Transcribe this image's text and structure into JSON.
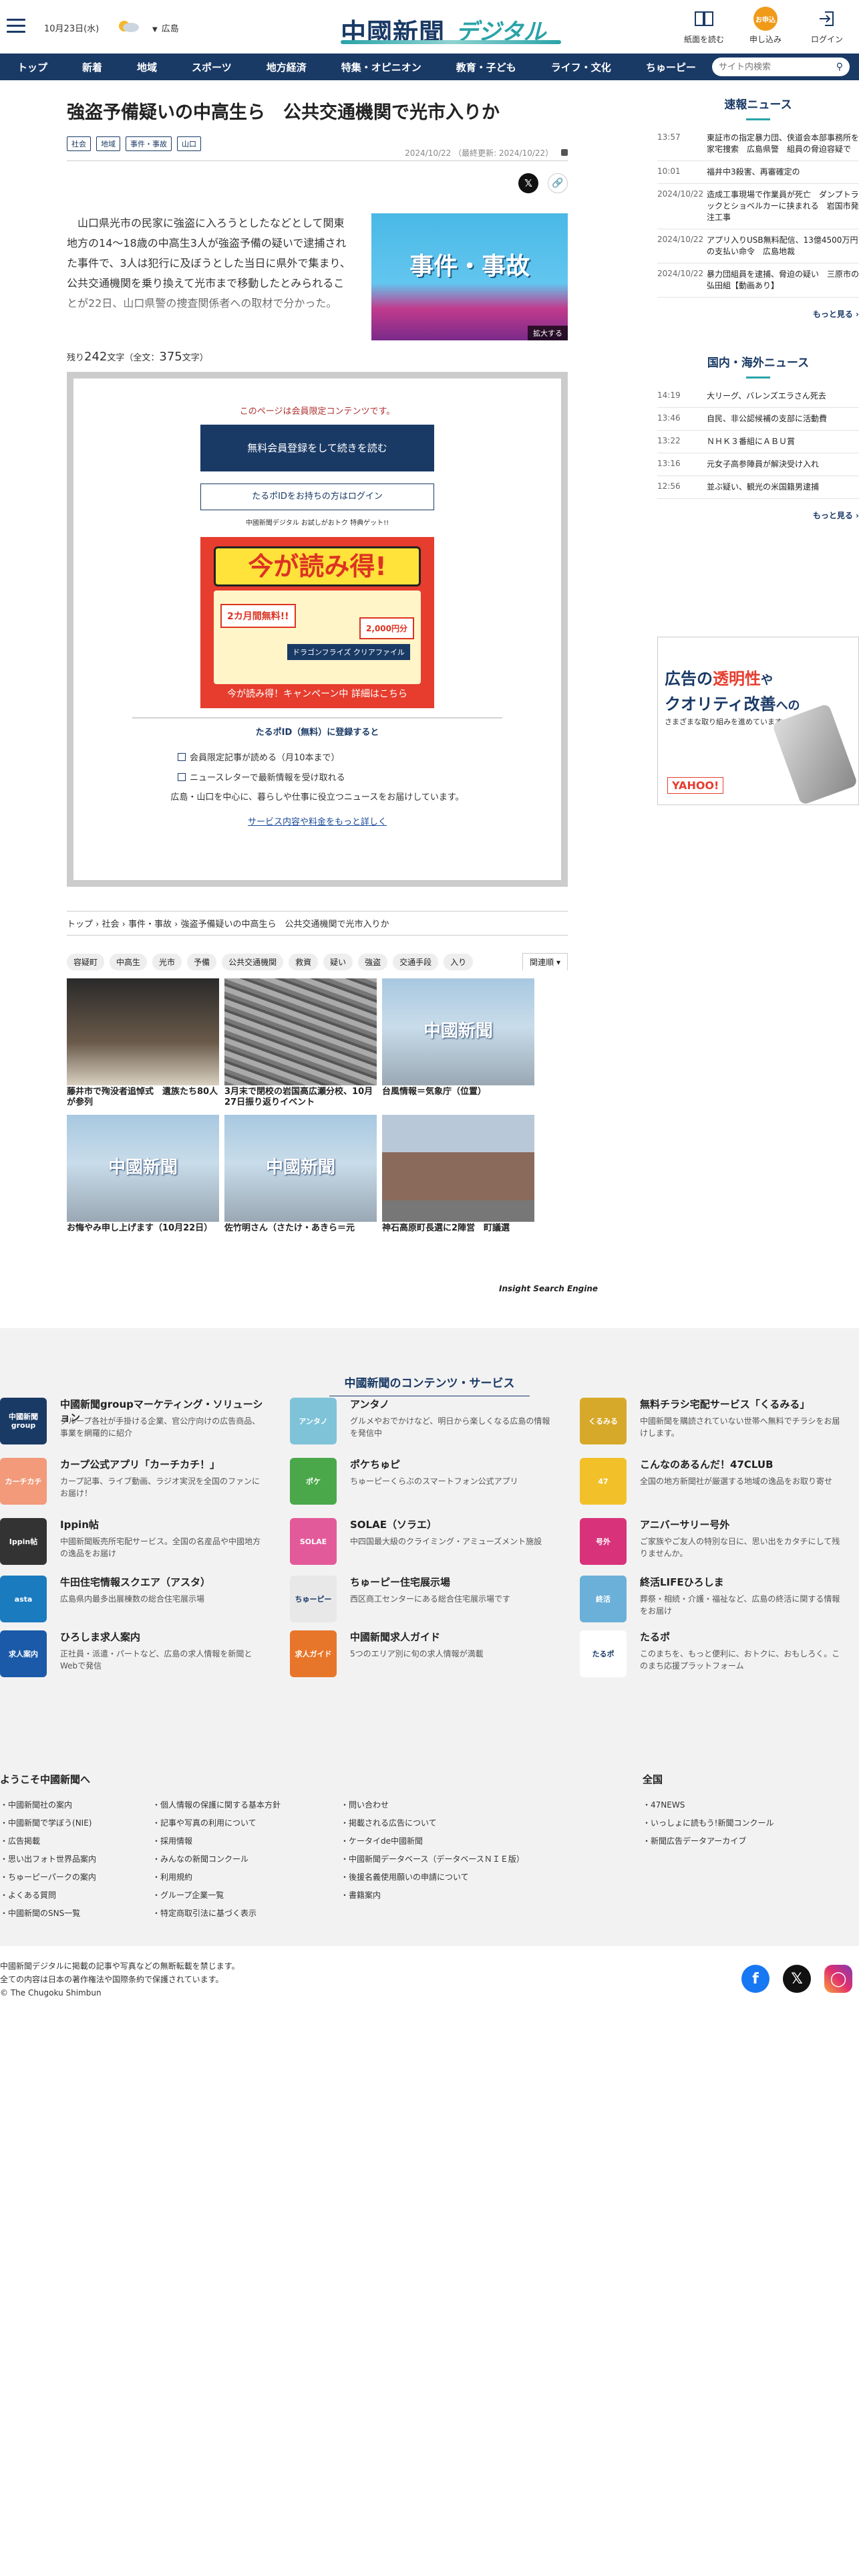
{
  "header": {
    "date": "10月23日(水)",
    "region": "広島",
    "logo_main": "中國新聞",
    "logo_sub": "デジタル",
    "icons": [
      {
        "label": "紙面を読む",
        "icon": "newspaper-icon"
      },
      {
        "label": "申し込み",
        "icon": "apply-icon",
        "badge": "お申込"
      },
      {
        "label": "ログイン",
        "icon": "login-icon"
      }
    ]
  },
  "nav": {
    "items": [
      "トップ",
      "新着",
      "地域",
      "スポーツ",
      "地方経済",
      "特集・オピニオン",
      "教育・子ども",
      "ライフ・文化",
      "ちゅーピー"
    ],
    "search_placeholder": "サイト内検索"
  },
  "article": {
    "title": "強盗予備疑いの中高生ら　公共交通機関で光市入りか",
    "tags": [
      "社会",
      "地域",
      "事件・事故",
      "山口"
    ],
    "date": "2024/10/22",
    "updated": "（最終更新: 2024/10/22）",
    "lead": "　山口県光市の民家に強盗に入ろうとしたなどとして関東地方の14～18歳の中高生3人が強盗予備の疑いで逮捕された事件で、3人は犯行に及ぼうとした当日に県外で集まり、公共交通機関を乗り換えて光市まで移動したとみられることが22日、山口県警の捜査関係者への取材で分かった。",
    "image_label": "事件・事故",
    "expand_label": "拡大する",
    "remain_prefix": "残り",
    "remain_count": "242",
    "remain_mid": "文字（全文：",
    "total_count": "375",
    "remain_suffix": "文字）"
  },
  "paywall": {
    "note": "このページは会員限定コンテンツです。",
    "register_btn": "無料会員登録をして続きを読む",
    "login_btn": "たるポIDをお持ちの方はログイン",
    "banner_top": "中國新聞デジタル お試しがおトク 特典ゲット!!",
    "banner_big": "今が読み得!",
    "banner_c1": "2カ月間無料!!",
    "banner_c2": "2,000円分",
    "banner_c3": "ドラゴンフライズ クリアファイル",
    "banner_bottom": "今が読み得！キャンペーン中 詳細はこちら",
    "sub_title": "たるポID（無料）に登録すると",
    "benefits": [
      "会員限定記事が読める（月10本まで）",
      "ニュースレターで最新情報を受け取れる"
    ],
    "desc": "広島・山口を中心に、暮らしや仕事に役立つニュースをお届けしています。",
    "more_link": "サービス内容や料金をもっと詳しく"
  },
  "breadcrumb": [
    "トップ",
    "社会",
    "事件・事故",
    "強盗予備疑いの中高生ら　公共交通機関で光市入りか"
  ],
  "keywords": [
    "容疑町",
    "中高生",
    "光市",
    "予備",
    "公共交通機関",
    "救資",
    "疑い",
    "強盗",
    "交通手段",
    "入り"
  ],
  "sort_label": "関連順",
  "related": [
    {
      "caption": "藤井市で殉没者追悼式　遺族たち80人が参列",
      "style": "photo1"
    },
    {
      "caption": "3月末で閉校の岩国高広瀬分校、10月27日振り返りイベント",
      "style": "photo2"
    },
    {
      "caption": "台風情報＝気象庁（位置）",
      "style": "cg"
    },
    {
      "caption": "お悔やみ申し上げます（10月22日）",
      "style": "cg"
    },
    {
      "caption": "佐竹明さん（さたけ・あきら＝元",
      "style": "cg"
    },
    {
      "caption": "神石高原町長選に2陣営　町議選",
      "style": "photo3"
    }
  ],
  "related_engine": "Insight Search Engine",
  "side": {
    "breaking_title": "速報ニュース",
    "breaking": [
      {
        "time": "13:57",
        "headline": "東証市の指定暴力団、侠道会本部事務所を家宅捜索　広島県警　組員の脅迫容疑で"
      },
      {
        "time": "10:01",
        "headline": "福井中3殺害、再審確定の"
      },
      {
        "time": "2024/10/22",
        "headline": "造成工事現場で作業員が死亡　ダンプトラックとショベルカーに挟まれる　岩国市発注工事"
      },
      {
        "time": "2024/10/22",
        "headline": "アプリ入りUSB無料配信、13億4500万円の支払い命令　広島地裁"
      },
      {
        "time": "2024/10/22",
        "headline": "暴力団組員を逮捕、脅迫の疑い　三原市の弘田組【動画あり】"
      }
    ],
    "more": "もっと見る",
    "world_title": "国内・海外ニュース",
    "world": [
      {
        "time": "14:19",
        "headline": "大リーグ、バレンズエラさん死去"
      },
      {
        "time": "13:46",
        "headline": "自民、非公認候補の支部に活動費"
      },
      {
        "time": "13:22",
        "headline": "ＮＨＫ３番組にＡＢＵ賞"
      },
      {
        "time": "13:16",
        "headline": "元女子高参陣員が解決受け入れ"
      },
      {
        "time": "12:56",
        "headline": "並ぶ疑い、観光の米国籍男逮捕"
      }
    ]
  },
  "ad": {
    "line1a": "広告の",
    "line1b": "透明性",
    "line1c": "や",
    "line2": "クオリティ改善",
    "line2b": "への",
    "line3": "さまざまな取り組みを進めています。",
    "brand": "YAHOO!"
  },
  "services": {
    "title": "中國新聞のコンテンツ・サービス",
    "items": [
      {
        "name": "中國新聞groupマーケティング・ソリューション",
        "desc": "グループ各社が手掛ける企業、官公庁向けの広告商品、事業を網羅的に紹介",
        "icon": "中國新聞group",
        "color": "#1a3a66"
      },
      {
        "name": "アンタノ",
        "desc": "グルメやおでかけなど、明日から楽しくなる広島の情報を発信中",
        "icon": "アンタノ",
        "color": "#7fc3d8"
      },
      {
        "name": "無料チラシ宅配サービス「くるみる」",
        "desc": "中國新聞を購読されていない世帯へ無料でチラシをお届けします。",
        "icon": "くるみる",
        "color": "#d7a92a"
      },
      {
        "name": "カープ公式アプリ「カーチカチ！」",
        "desc": "カープ記事、ライブ動画、ラジオ実況を全国のファンにお届け！",
        "icon": "カーチカチ",
        "color": "#f29a7a"
      },
      {
        "name": "ポケちゅピ",
        "desc": "ちゅーピーくらぶのスマートフォン公式アプリ",
        "icon": "ポケ",
        "color": "#4aa84a"
      },
      {
        "name": "こんなのあるんだ！47CLUB",
        "desc": "全国の地方新聞社が厳選する地域の逸品をお取り寄せ",
        "icon": "47",
        "color": "#f2c12a"
      },
      {
        "name": "Ippin帖",
        "desc": "中國新聞販売所宅配サービス。全国の名産品や中國地方の逸品をお届け",
        "icon": "Ippin帖",
        "color": "#333333"
      },
      {
        "name": "SOLAE（ソラエ）",
        "desc": "中四国最大級のクライミング・アミューズメント施設",
        "icon": "SOLAE",
        "color": "#e35a9a"
      },
      {
        "name": "アニバーサリー号外",
        "desc": "ご家族やご友人の特別な日に、思い出をカタチにして残りませんか。",
        "icon": "号外",
        "color": "#d8327a"
      },
      {
        "name": "牛田住宅情報スクエア（アスタ）",
        "desc": "広島県内最多出展棟数の総合住宅展示場",
        "icon": "asta",
        "color": "#1a7bbf"
      },
      {
        "name": "ちゅーピー住宅展示場",
        "desc": "西区商工センターにある総合住宅展示場です",
        "icon": "ちゅーピー",
        "color": "#e8e8e8"
      },
      {
        "name": "終活LIFEひろしま",
        "desc": "葬祭・相続・介護・福祉など、広島の終活に関する情報をお届け",
        "icon": "終活",
        "color": "#6ab0d8"
      },
      {
        "name": "ひろしま求人案内",
        "desc": "正社員・派遣・パートなど、広島の求人情報を新聞とWebで発信",
        "icon": "求人案内",
        "color": "#1a5aa8"
      },
      {
        "name": "中國新聞求人ガイド",
        "desc": "5つのエリア別に旬の求人情報が満載",
        "icon": "求人ガイド",
        "color": "#e8762a"
      },
      {
        "name": "たるポ",
        "desc": "このまちを、もっと便利に、おトクに、おもしろく。このまち応援プラットフォーム",
        "icon": "たるポ",
        "color": "#ffffff"
      }
    ]
  },
  "footer": {
    "welcome": "ようこそ中國新聞へ",
    "col1": [
      "中國新聞社の案内",
      "中國新聞で学ぼう(NIE)",
      "広告掲載",
      "思い出フォト世界品案内",
      "ちゅーピーパークの案内",
      "よくある質問",
      "中國新聞のSNS一覧"
    ],
    "col2": [
      "個人情報の保護に関する基本方針",
      "記事や写真の利用について",
      "採用情報",
      "みんなの新聞コンクール",
      "利用規約",
      "グループ企業一覧",
      "特定商取引法に基づく表示"
    ],
    "col3": [
      "問い合わせ",
      "掲載される広告について",
      "ケータイde中國新聞",
      "中國新聞データベース（データベースＮＩＥ版）",
      "後援名義使用願いの申請について",
      "書籍案内"
    ],
    "national_title": "全国",
    "national": [
      "47NEWS",
      "いっしょに読もう!新聞コンクール",
      "新聞広告データアーカイブ"
    ],
    "copy1": "中國新聞デジタルに掲載の記事や写真などの無断転載を禁じます。",
    "copy2": "全ての内容は日本の著作権法や国際条約で保護されています。",
    "copy3": "© The Chugoku Shimbun"
  },
  "colors": {
    "navy": "#1a3a66",
    "teal": "#2aa3a8",
    "accent": "#f09a1a"
  }
}
